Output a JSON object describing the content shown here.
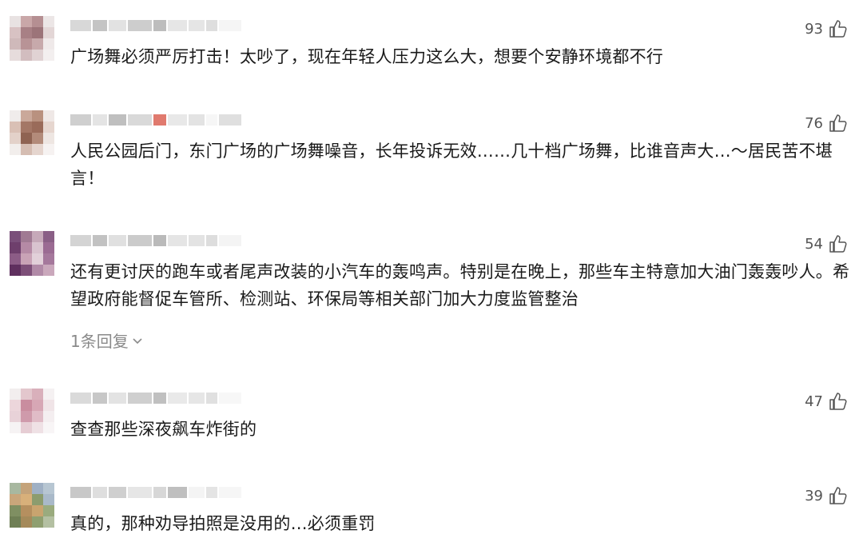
{
  "comments": [
    {
      "text": "广场舞必须严厉打击！太吵了，现在年轻人压力这么大，想要个安静环境都不行",
      "likes": "93",
      "avatar_colors": [
        "#e8e2e2",
        "#c9a7a8",
        "#b58f92",
        "#ece6e6",
        "#d8c2c3",
        "#a88085",
        "#9c7479",
        "#e3d6d6",
        "#cfb9ba",
        "#b89396",
        "#c7a9ab",
        "#efe9e9",
        "#e6dcdc",
        "#d2bdbf",
        "#e0d2d3",
        "#f3efef"
      ],
      "name_blur_colors": [
        "#d8d8d8",
        "#c4c4c4",
        "#e2e2e2",
        "#cdcdcd",
        "#bdbdbd",
        "#e6e6e6",
        "#d3d3d3",
        "#c8c8c8",
        "#eeeeee"
      ]
    },
    {
      "text": "人民公园后门，东门广场的广场舞噪音，长年投诉无效……几十档广场舞，比谁音声大…～居民苦不堪言！",
      "likes": "76",
      "avatar_colors": [
        "#f0eceb",
        "#caa89a",
        "#b9917f",
        "#efe8e6",
        "#d9c0b5",
        "#a47766",
        "#9a6b5a",
        "#e6d6cf",
        "#e3d1c9",
        "#8f6352",
        "#b38b7a",
        "#eee6e2",
        "#f2eeec",
        "#d5bdb2",
        "#e5d5ce",
        "#f6f2f1"
      ],
      "name_blur_colors": [
        "#cfcfcf",
        "#e4e4e4",
        "#bfbfbf",
        "#d9d9d9",
        "#e07a6e",
        "#e8e8e8",
        "#d0d0d0",
        "#f0f0f0",
        "#c9c9c9"
      ]
    },
    {
      "text": "还有更讨厌的跑车或者尾声改装的小汽车的轰鸣声。特别是在晚上，那些车主特意加大油门轰轰吵人。希望政府能督促车管所、检测站、环保局等相关部门加大力度监管整治",
      "likes": "54",
      "replies": "1条回复",
      "avatar_colors": [
        "#7a4f7a",
        "#a07a93",
        "#c6a9b9",
        "#8a5f86",
        "#6e3f6c",
        "#b58aa5",
        "#d9c3cf",
        "#9b6b93",
        "#8c5c86",
        "#c9a3b6",
        "#e2d0d9",
        "#a5789c",
        "#5f2f5e",
        "#7d4f78",
        "#b18aa7",
        "#caa8bc"
      ],
      "name_blur_colors": [
        "#d4d4d4",
        "#c2c2c2",
        "#e0e0e0",
        "#cbcbcb",
        "#bababa",
        "#e5e5e5",
        "#d1d1d1",
        "#c6c6c6",
        "#ececec"
      ]
    },
    {
      "text": "查查那些深夜飙车炸街的",
      "likes": "47",
      "avatar_colors": [
        "#f2eeee",
        "#e3c7cd",
        "#d9b0bb",
        "#f5f1f2",
        "#ecd6db",
        "#c98d9f",
        "#d7a7b5",
        "#f0e4e7",
        "#e8d2d8",
        "#cf9aab",
        "#e0bcc7",
        "#f4eef0",
        "#f6f3f4",
        "#e6cdd4",
        "#efe1e5",
        "#f8f5f6"
      ],
      "name_blur_colors": [
        "#dadada",
        "#c7c7c7",
        "#e3e3e3",
        "#cfcfcf",
        "#c0c0c0",
        "#e9e9e9",
        "#d6d6d6",
        "#cccccc",
        "#f1f1f1"
      ]
    },
    {
      "text": "真的，那种劝导拍照是没用的…必须重罚",
      "likes": "39",
      "avatar_colors": [
        "#a8b8a0",
        "#c4a37a",
        "#9fb0c4",
        "#b7c6d2",
        "#c9a67b",
        "#d8b07a",
        "#8c9c6e",
        "#a9b9c9",
        "#7f8f62",
        "#b58f5f",
        "#c9a46f",
        "#9aab7e",
        "#6f7f55",
        "#a58a5a",
        "#8f9f70",
        "#b4c0a2"
      ],
      "name_blur_colors": [
        "#c8c8c8",
        "#dedede",
        "#cfcfcf",
        "#e6e6e6",
        "#d7d7d7",
        "#bfbfbf",
        "#ececec",
        "#d2d2d2",
        "#f0f0f0"
      ]
    }
  ],
  "colors": {
    "text": "#1a1a1a",
    "muted": "#8a8a8a",
    "icon": "#555555"
  },
  "icons": {
    "like": "thumbs-up-icon",
    "expand": "chevron-down-icon"
  }
}
